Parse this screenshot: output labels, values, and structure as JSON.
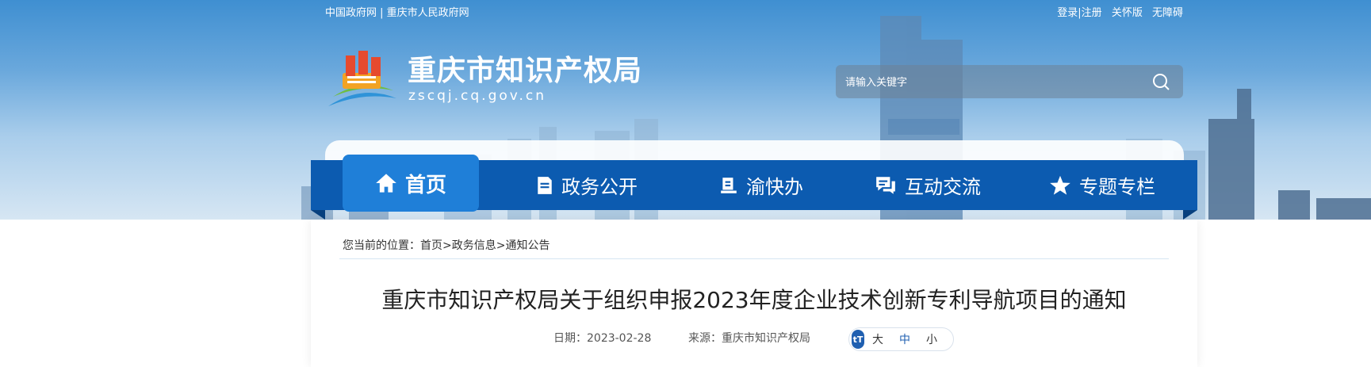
{
  "top_links": {
    "gov_site": "中国政府网",
    "separator": " | ",
    "cq_gov_site": "重庆市人民政府网",
    "login_register": "登录|注册",
    "care_mode": "关怀版",
    "accessibility": "无障碍"
  },
  "header": {
    "site_title": "重庆市知识产权局",
    "site_domain": "zscqj.cq.gov.cn"
  },
  "search": {
    "placeholder": "请输入关键字",
    "icon": "search-icon"
  },
  "nav": {
    "items": [
      {
        "label": "首页",
        "icon": "home-icon",
        "active": true
      },
      {
        "label": "政务公开",
        "icon": "document-icon",
        "active": false
      },
      {
        "label": "渝快办",
        "icon": "service-icon",
        "active": false
      },
      {
        "label": "互动交流",
        "icon": "chat-icon",
        "active": false
      },
      {
        "label": "专题专栏",
        "icon": "star-icon",
        "active": false
      }
    ]
  },
  "breadcrumb": {
    "prefix": "您当前的位置：",
    "items": [
      "首页",
      "政务信息",
      "通知公告"
    ],
    "separator": ">"
  },
  "article": {
    "title": "重庆市知识产权局关于组织申报2023年度企业技术创新专利导航项目的通知",
    "date_label": "日期：",
    "date": "2023-02-28",
    "source_label": "来源：",
    "source": "重庆市知识产权局"
  },
  "font_size": {
    "icon_text": "tT",
    "large": "大",
    "medium": "中",
    "small": "小"
  },
  "colors": {
    "nav_bg": "#0c5bb0",
    "nav_active": "#1f7fd8",
    "font_switch_icon": "#1f5fb0"
  }
}
